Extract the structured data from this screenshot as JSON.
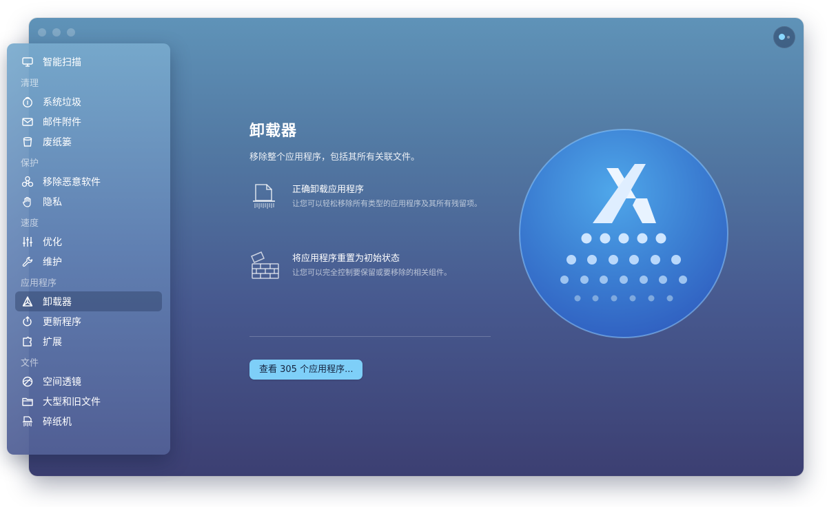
{
  "sidebar": {
    "top": {
      "label": "智能扫描",
      "icon": "monitor-icon"
    },
    "sections": [
      {
        "label": "清理",
        "items": [
          {
            "label": "系统垃圾",
            "icon": "system-junk-icon"
          },
          {
            "label": "邮件附件",
            "icon": "mail-icon"
          },
          {
            "label": "废纸篓",
            "icon": "trash-icon"
          }
        ]
      },
      {
        "label": "保护",
        "items": [
          {
            "label": "移除恶意软件",
            "icon": "biohazard-icon"
          },
          {
            "label": "隐私",
            "icon": "hand-icon"
          }
        ]
      },
      {
        "label": "速度",
        "items": [
          {
            "label": "优化",
            "icon": "sliders-icon"
          },
          {
            "label": "维护",
            "icon": "wrench-icon"
          }
        ]
      },
      {
        "label": "应用程序",
        "items": [
          {
            "label": "卸载器",
            "icon": "uninstaller-icon",
            "active": true
          },
          {
            "label": "更新程序",
            "icon": "updater-icon"
          },
          {
            "label": "扩展",
            "icon": "extensions-icon"
          }
        ]
      },
      {
        "label": "文件",
        "items": [
          {
            "label": "空间透镜",
            "icon": "space-lens-icon"
          },
          {
            "label": "大型和旧文件",
            "icon": "folder-icon"
          },
          {
            "label": "碎纸机",
            "icon": "shredder-icon"
          }
        ]
      }
    ]
  },
  "main": {
    "title": "卸载器",
    "subtitle": "移除整个应用程序，包括其所有关联文件。",
    "features": [
      {
        "title": "正确卸载应用程序",
        "description": "让您可以轻松移除所有类型的应用程序及其所有残留项。",
        "icon": "shredded-document-icon"
      },
      {
        "title": "将应用程序重置为初始状态",
        "description": "让您可以完全控制要保留或要移除的相关组件。",
        "icon": "brick-wall-icon"
      }
    ],
    "cta_label": "查看 305 个应用程序..."
  },
  "colors": {
    "accent_button": "#7ecff8",
    "hero_circle": "#3f7fcf",
    "active_item_bg": "#2d3e64"
  }
}
